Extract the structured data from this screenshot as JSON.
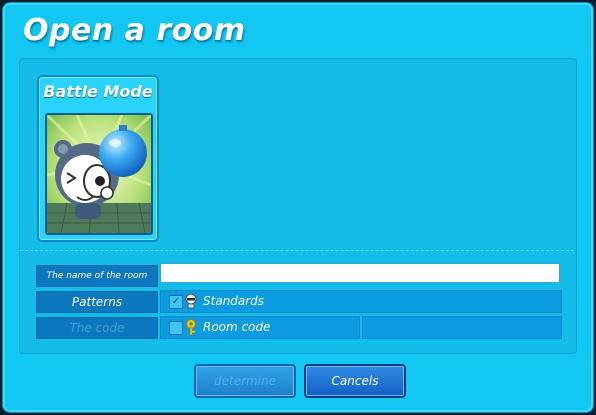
{
  "dialog": {
    "title": "Open a room",
    "mode_card": {
      "title": "Battle Mode"
    },
    "fields": {
      "room_name": {
        "label": "The name of the room",
        "value": ""
      },
      "patterns": {
        "label": "Patterns",
        "option": "Standards",
        "checked": true
      },
      "code": {
        "label": "The code",
        "option": "Room code",
        "checked": false,
        "enabled": false
      }
    },
    "buttons": {
      "determine": "determine",
      "cancel": "Cancels"
    }
  },
  "colors": {
    "window_bg": "#12c7f2",
    "label_bg": "#0a77bf",
    "button_bg": "#1260c4"
  }
}
